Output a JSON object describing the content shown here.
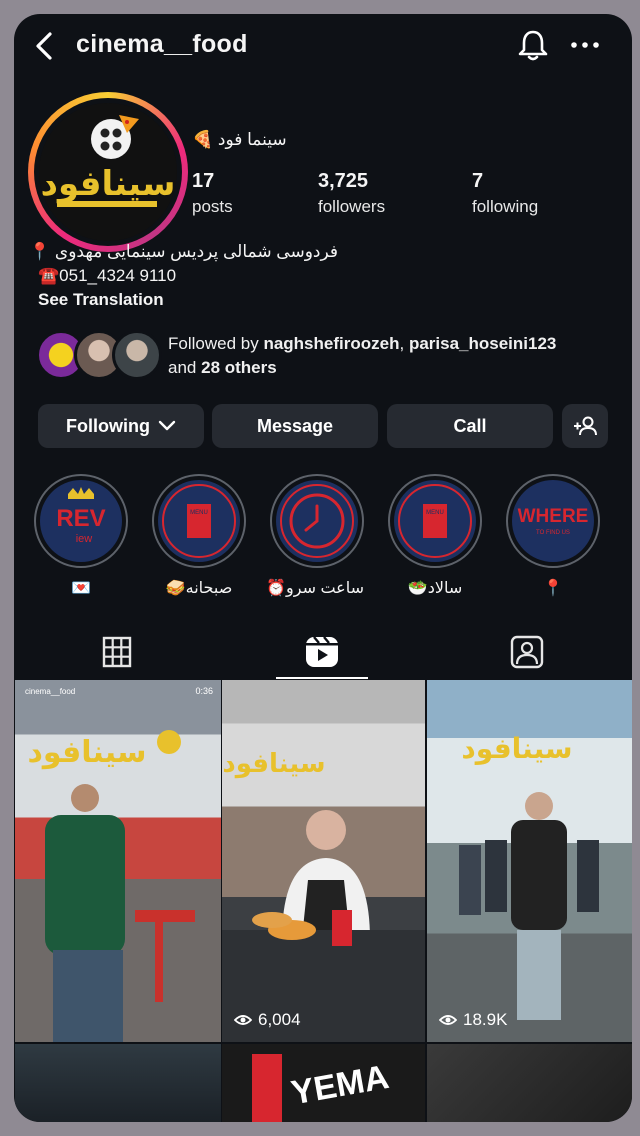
{
  "header": {
    "username": "cinema__food"
  },
  "profile": {
    "display_name": "سینما فود 🍕",
    "avatar_text": "سینافود",
    "stats": [
      {
        "value": "17",
        "label": "posts"
      },
      {
        "value": "3,725",
        "label": "followers"
      },
      {
        "value": "7",
        "label": "following"
      }
    ],
    "bio": {
      "address": "فردوسی شمالی پردیس سینمایی مهدوی 📍",
      "phone": "☎️051_4324 9110",
      "see_translation": "See Translation"
    },
    "followed_by": {
      "prefix": "Followed by",
      "user1": "naghshefiroozeh",
      "sep": ",",
      "user2": "parisa_hoseini123",
      "and": "and",
      "others": "28 others"
    }
  },
  "actions": {
    "following": "Following",
    "message": "Message",
    "call": "Call"
  },
  "highlights": [
    {
      "title": "REV",
      "sub": "iew",
      "caption": "💌"
    },
    {
      "title": "MENU",
      "sub": "",
      "caption": "صبحانه🥪"
    },
    {
      "title": "",
      "sub": "",
      "caption": "ساعت سرو⏰"
    },
    {
      "title": "MENU",
      "sub": "",
      "caption": "سالاد🥗"
    },
    {
      "title": "WHERE",
      "sub": "TO FIND US",
      "caption": "📍"
    }
  ],
  "grid": {
    "items": [
      {
        "overlay_user": "cinema__food",
        "duration": "0:36",
        "views": "",
        "sign": "سینافود"
      },
      {
        "overlay_user": "",
        "duration": "",
        "views": "6,004",
        "sign": "سینافود"
      },
      {
        "overlay_user": "",
        "duration": "",
        "views": "18.9K",
        "sign": "سینافود"
      }
    ],
    "bottom_text": "YEMA"
  },
  "colors": {
    "background": "#0e1116",
    "button": "#262a31",
    "accent_yellow": "#e8c12c",
    "highlight_blue": "#1d3060",
    "highlight_red": "#d7262f"
  }
}
